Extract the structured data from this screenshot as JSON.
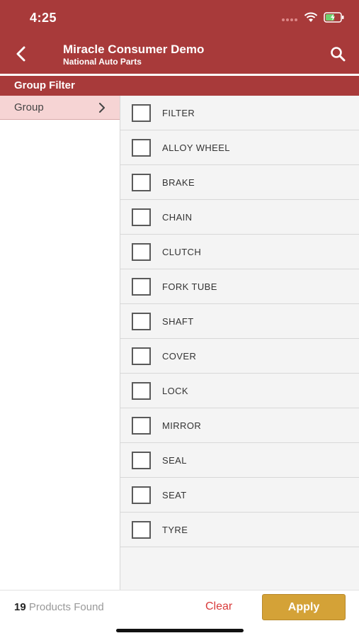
{
  "status_bar": {
    "time": "4:25",
    "icons": [
      "signal-dots-icon",
      "wifi-icon",
      "battery-charging-icon"
    ]
  },
  "header": {
    "title": "Miracle Consumer Demo",
    "subtitle": "National Auto Parts",
    "back_icon": "chevron-left-icon",
    "search_icon": "search-icon"
  },
  "section": {
    "title": "Group Filter"
  },
  "left_panel": {
    "group_tab_label": "Group",
    "group_tab_icon": "chevron-right-icon"
  },
  "filters": [
    {
      "label": "FILTER",
      "checked": false
    },
    {
      "label": "ALLOY WHEEL",
      "checked": false
    },
    {
      "label": "BRAKE",
      "checked": false
    },
    {
      "label": "CHAIN",
      "checked": false
    },
    {
      "label": "CLUTCH",
      "checked": false
    },
    {
      "label": "FORK TUBE",
      "checked": false
    },
    {
      "label": "SHAFT",
      "checked": false
    },
    {
      "label": "COVER",
      "checked": false
    },
    {
      "label": "LOCK",
      "checked": false
    },
    {
      "label": "MIRROR",
      "checked": false
    },
    {
      "label": "SEAL",
      "checked": false
    },
    {
      "label": "SEAT",
      "checked": false
    },
    {
      "label": "TYRE",
      "checked": false
    }
  ],
  "footer": {
    "product_count": "19",
    "products_found_label": "Products Found",
    "clear_label": "Clear",
    "apply_label": "Apply"
  },
  "colors": {
    "brand": "#a83a3a",
    "group_tab_bg": "#f6d4d4",
    "clear": "#d93b3b",
    "apply": "#d4a237"
  }
}
